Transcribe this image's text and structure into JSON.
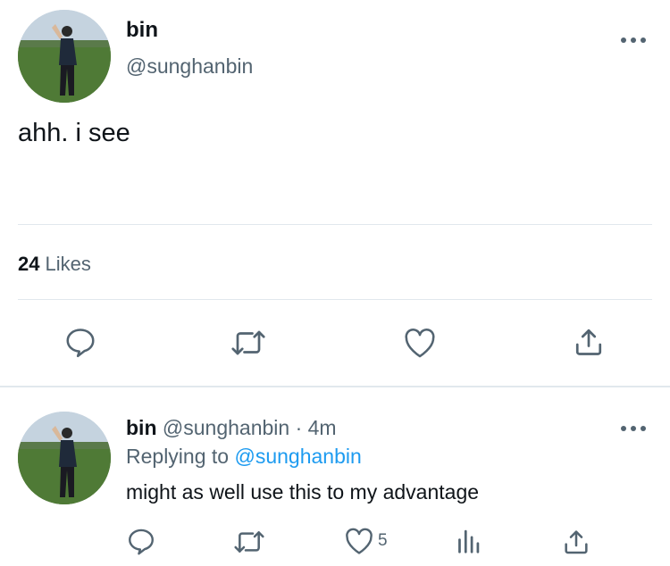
{
  "main_tweet": {
    "display_name": "bin",
    "handle": "@sunghanbin",
    "text": "ahh. i see",
    "likes_count": "24",
    "likes_label": "Likes",
    "actions": [
      "reply-icon",
      "retweet-icon",
      "like-icon",
      "share-icon"
    ]
  },
  "reply_tweet": {
    "display_name": "bin",
    "handle": "@sunghanbin",
    "separator": "·",
    "time": "4m",
    "replying_prefix": "Replying to",
    "replying_to": "@sunghanbin",
    "text": "might as well use this to my advantage",
    "like_count": "5",
    "actions": [
      "reply-icon",
      "retweet-icon",
      "like-icon",
      "analytics-icon",
      "share-icon"
    ]
  },
  "colors": {
    "text": "#0f1419",
    "secondary": "#536471",
    "link": "#1d9bf0",
    "divider": "#e1e8ed"
  }
}
